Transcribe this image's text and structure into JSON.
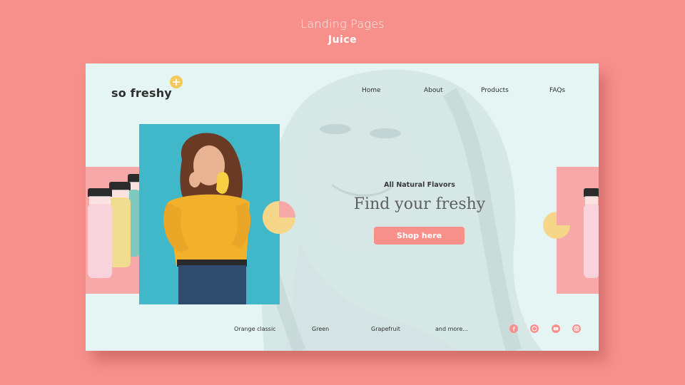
{
  "page": {
    "subtitle": "Landing Pages",
    "title": "Juice"
  },
  "brand": {
    "logo": "so freshy",
    "logo_badge": "+"
  },
  "nav": [
    {
      "label": "Home"
    },
    {
      "label": "About"
    },
    {
      "label": "Products"
    },
    {
      "label": "FAQs"
    }
  ],
  "hero": {
    "eyebrow": "All Natural Flavors",
    "headline": "Find your freshy",
    "cta": "Shop here"
  },
  "footer_links": [
    {
      "label": "Orange classic"
    },
    {
      "label": "Green"
    },
    {
      "label": "Grapefruit"
    },
    {
      "label": "and more..."
    }
  ],
  "social_icons": [
    "facebook-icon",
    "whatsapp-icon",
    "youtube-icon",
    "instagram-icon"
  ],
  "colors": {
    "background": "#f7908b",
    "card": "#e4f5f4",
    "accent_pink": "#f7a8a8",
    "accent_yellow": "#f6c95b",
    "photo_bg": "#41b8c9",
    "cta": "#f7908b"
  }
}
